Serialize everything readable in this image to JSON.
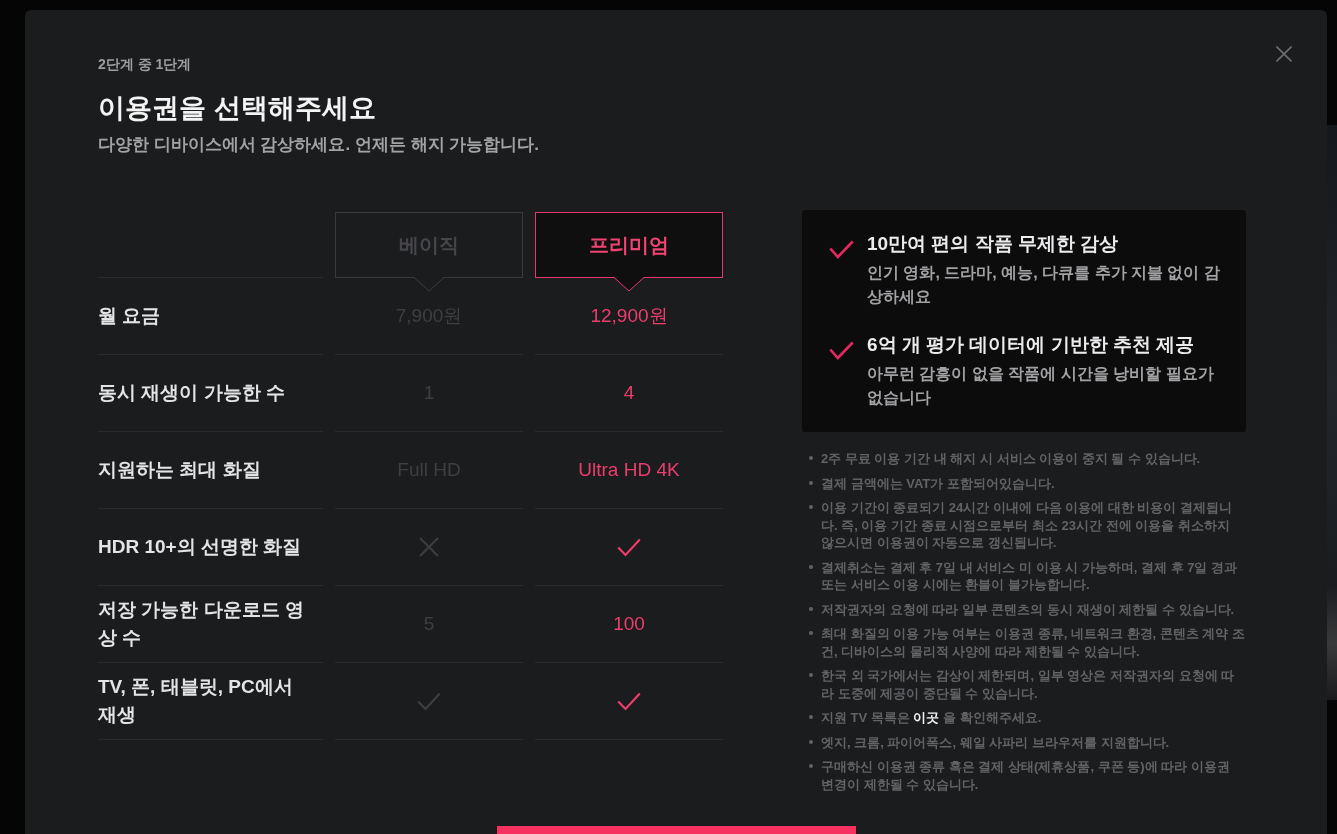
{
  "step": "2단계 중 1단계",
  "title": "이용권을 선택해주세요",
  "subtitle": "다양한 디바이스에서 감상하세요. 언제든 해지 가능합니다.",
  "plans": [
    {
      "name": "베이직",
      "selected": false
    },
    {
      "name": "프리미엄",
      "selected": true
    }
  ],
  "comparison_rows": [
    {
      "label": "월 요금",
      "cells": [
        {
          "kind": "text",
          "text": "7,900원"
        },
        {
          "kind": "text",
          "text": "12,900원"
        }
      ]
    },
    {
      "label": "동시 재생이 가능한 수",
      "cells": [
        {
          "kind": "text",
          "text": "1"
        },
        {
          "kind": "text",
          "text": "4"
        }
      ]
    },
    {
      "label": "지원하는 최대 화질",
      "cells": [
        {
          "kind": "text",
          "text": "Full HD"
        },
        {
          "kind": "text",
          "text": "Ultra HD 4K"
        }
      ]
    },
    {
      "label": "HDR 10+의 선명한 화질",
      "cells": [
        {
          "kind": "cross"
        },
        {
          "kind": "check"
        }
      ]
    },
    {
      "label": "저장 가능한 다운로드 영상 수",
      "cells": [
        {
          "kind": "text",
          "text": "5"
        },
        {
          "kind": "text",
          "text": "100"
        }
      ]
    },
    {
      "label": "TV, 폰, 태블릿, PC에서 재생",
      "cells": [
        {
          "kind": "check"
        },
        {
          "kind": "check"
        }
      ]
    }
  ],
  "benefits": [
    {
      "title": "10만여 편의 작품 무제한 감상",
      "description": "인기 영화, 드라마, 예능, 다큐를 추가 지불 없이 감상하세요"
    },
    {
      "title": "6억 개 평가 데이터에 기반한 추천 제공",
      "description": "아무런 감흥이 없을 작품에 시간을 낭비할 필요가 없습니다"
    }
  ],
  "notes": [
    {
      "kind": "text",
      "text": "2주 무료 이용 기간 내 해지 시 서비스 이용이 중지 될 수 있습니다."
    },
    {
      "kind": "text",
      "text": "결제 금액에는 VAT가 포함되어있습니다."
    },
    {
      "kind": "text",
      "text": "이용 기간이 종료되기 24시간 이내에 다음 이용에 대한 비용이 결제됩니다. 즉, 이용 기간 종료 시점으로부터 최소 23시간 전에 이용을 취소하지 않으시면 이용권이 자동으로 갱신됩니다."
    },
    {
      "kind": "text",
      "text": "결제취소는 결제 후 7일 내 서비스 미 이용 시 가능하며, 결제 후 7일 경과 또는 서비스 이용 시에는 환불이 불가능합니다."
    },
    {
      "kind": "text",
      "text": "저작권자의 요청에 따라 일부 콘텐츠의 동시 재생이 제한될 수 있습니다."
    },
    {
      "kind": "text",
      "text": "최대 화질의 이용 가능 여부는 이용권 종류, 네트워크 환경, 콘텐츠 계약 조건, 디바이스의 물리적 사양에 따라 제한될 수 있습니다."
    },
    {
      "kind": "text",
      "text": "한국 외 국가에서는 감상이 제한되며, 일부 영상은 저작권자의 요청에 따라 도중에 제공이 중단될 수 있습니다."
    },
    {
      "kind": "link",
      "text_before": "지원 TV 목록은 ",
      "link": "이곳",
      "text_after": " 을 확인해주세요."
    },
    {
      "kind": "text",
      "text": "엣지, 크롬, 파이어폭스, 웨일 사파리 브라우저를 지원합니다."
    },
    {
      "kind": "text",
      "text": "구매하신 이용권 종류 혹은 결제 상태(제휴상품, 쿠폰 등)에 따라 이용권 변경이 제한될 수 있습니다."
    }
  ]
}
